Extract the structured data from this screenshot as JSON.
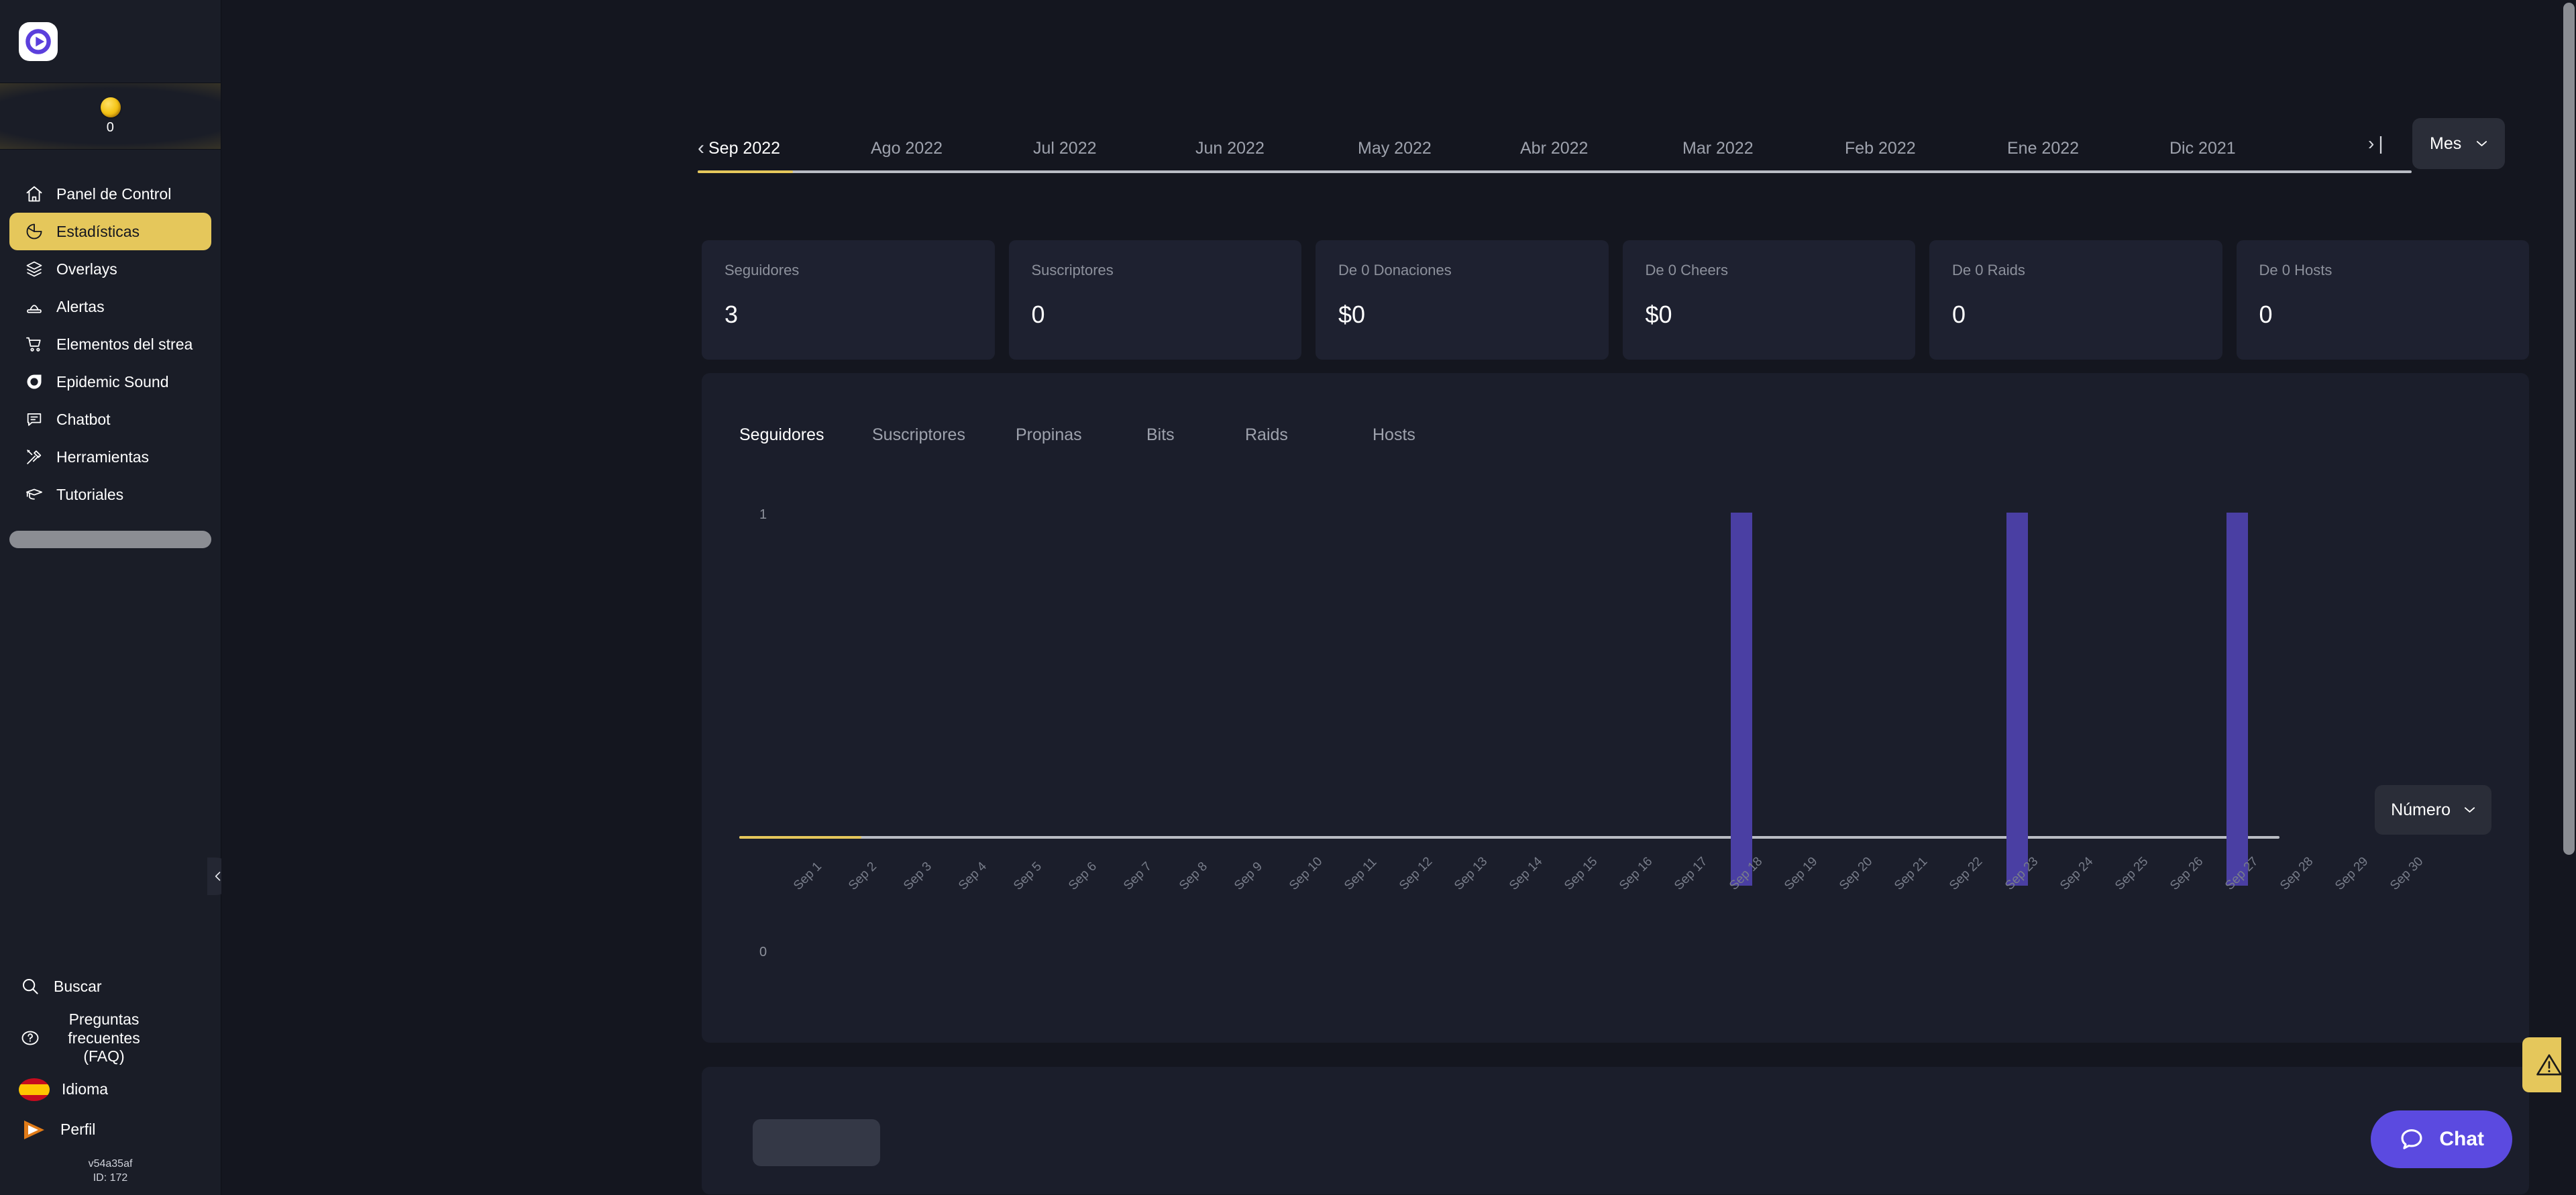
{
  "brand": {
    "logo_icon": "play-circle-logo"
  },
  "coin_banner": {
    "icon": "coin-icon",
    "count": "0"
  },
  "sidebar": {
    "items": [
      {
        "label": "Panel de Control",
        "icon": "home-icon",
        "active": false
      },
      {
        "label": "Estadísticas",
        "icon": "pie-chart-icon",
        "active": true
      },
      {
        "label": "Overlays",
        "icon": "layers-icon",
        "active": false
      },
      {
        "label": "Alertas",
        "icon": "alert-beacon-icon",
        "active": false
      },
      {
        "label": "Elementos del strea",
        "icon": "cart-icon",
        "active": false
      },
      {
        "label": "Epidemic Sound",
        "icon": "epidemic-sound-icon",
        "active": false
      },
      {
        "label": "Chatbot",
        "icon": "chat-bubble-icon",
        "active": false
      },
      {
        "label": "Herramientas",
        "icon": "tools-icon",
        "active": false
      },
      {
        "label": "Tutoriales",
        "icon": "graduation-cap-icon",
        "active": false
      }
    ],
    "bottom": {
      "search_label": "Buscar",
      "search_icon": "search-icon",
      "faq_label_line1": "Preguntas",
      "faq_label_line2": "frecuentes",
      "faq_label_line3": "(FAQ)",
      "faq_icon": "question-circle-icon",
      "language_label": "Idioma",
      "language_icon": "spain-flag-icon",
      "profile_label": "Perfil",
      "profile_icon": "profile-play-logo-icon",
      "version": "v54a35af",
      "user_id": "ID: 172"
    },
    "collapse_icon": "chevron-left-icon"
  },
  "month_strip": {
    "prev_icon": "chevron-left-icon",
    "next_icon": "chevron-right-icon",
    "months": [
      "Sep 2022",
      "Ago 2022",
      "Jul 2022",
      "Jun 2022",
      "May 2022",
      "Abr 2022",
      "Mar 2022",
      "Feb 2022",
      "Ene 2022",
      "Dic 2021"
    ],
    "active_index": 0,
    "accent_color": "#e5c75b"
  },
  "period_dropdown": {
    "label": "Mes",
    "chevron_icon": "chevron-down-icon"
  },
  "stats": [
    {
      "label": "Seguidores",
      "value": "3"
    },
    {
      "label": "Suscriptores",
      "value": "0"
    },
    {
      "label": "De 0 Donaciones",
      "value": "$0"
    },
    {
      "label": "De 0 Cheers",
      "value": "$0"
    },
    {
      "label": "De 0 Raids",
      "value": "0"
    },
    {
      "label": "De 0 Hosts",
      "value": "0"
    }
  ],
  "chart_panel": {
    "tabs": [
      "Seguidores",
      "Suscriptores",
      "Propinas",
      "Bits",
      "Raids",
      "Hosts"
    ],
    "active_tab_index": 0,
    "unit_dropdown": {
      "label": "Número",
      "chevron_icon": "chevron-down-icon"
    }
  },
  "chart_data": {
    "type": "bar",
    "title": "",
    "xlabel": "",
    "ylabel": "",
    "ylim": [
      0,
      1
    ],
    "ytick_labels": [
      "1",
      "0"
    ],
    "grid": false,
    "legend": "none",
    "bar_color": "#4a3fa3",
    "categories": [
      "Sep 1",
      "Sep 2",
      "Sep 3",
      "Sep 4",
      "Sep 5",
      "Sep 6",
      "Sep 7",
      "Sep 8",
      "Sep 9",
      "Sep 10",
      "Sep 11",
      "Sep 12",
      "Sep 13",
      "Sep 14",
      "Sep 15",
      "Sep 16",
      "Sep 17",
      "Sep 18",
      "Sep 19",
      "Sep 20",
      "Sep 21",
      "Sep 22",
      "Sep 23",
      "Sep 24",
      "Sep 25",
      "Sep 26",
      "Sep 27",
      "Sep 28",
      "Sep 29",
      "Sep 30"
    ],
    "values": [
      0,
      0,
      0,
      0,
      0,
      0,
      0,
      0,
      0,
      0,
      0,
      0,
      0,
      0,
      0,
      0,
      0,
      1,
      0,
      0,
      0,
      0,
      1,
      0,
      0,
      0,
      1,
      0,
      0,
      0
    ]
  },
  "floating": {
    "warning_icon": "warning-triangle-icon",
    "warning_color": "#e5c75b",
    "chat_label": "Chat",
    "chat_icon": "chat-bubble-icon",
    "chat_color": "#5b4ae0"
  }
}
